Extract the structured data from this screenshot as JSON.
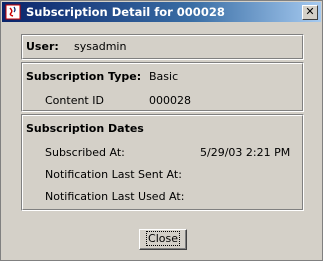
{
  "window": {
    "title": "Subscription Detail for 000028",
    "close_glyph": "✕"
  },
  "user": {
    "label": "User:",
    "value": "sysadmin"
  },
  "subscription": {
    "type_label": "Subscription Type:",
    "type_value": "Basic",
    "content_id_label": "Content ID",
    "content_id_value": "000028"
  },
  "dates": {
    "heading": "Subscription Dates",
    "subscribed_label": "Subscribed At:",
    "subscribed_value": "5/29/03 2:21 PM",
    "last_sent_label": "Notification Last Sent At:",
    "last_sent_value": "",
    "last_used_label": "Notification Last Used At:",
    "last_used_value": ""
  },
  "buttons": {
    "close_label": "Close"
  }
}
